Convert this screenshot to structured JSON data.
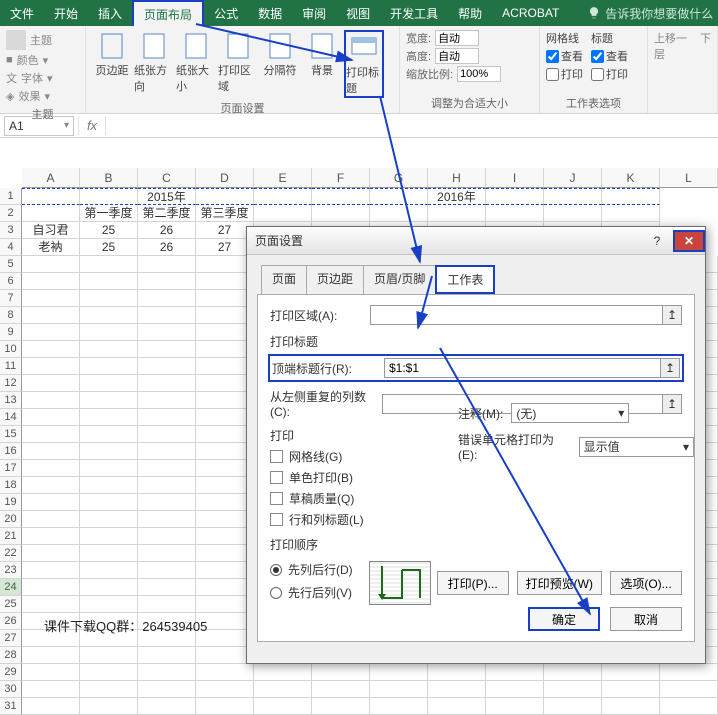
{
  "ribbon": {
    "tabs": [
      "文件",
      "开始",
      "插入",
      "页面布局",
      "公式",
      "数据",
      "审阅",
      "视图",
      "开发工具",
      "帮助",
      "ACROBAT"
    ],
    "active_tab": "页面布局",
    "tell_me": "告诉我你想要做什么",
    "themes": {
      "colors": "颜色",
      "fonts": "字体",
      "effects": "效果",
      "label": "主题",
      "main": "主题"
    },
    "page_setup": {
      "margins": "页边距",
      "orientation": "纸张方向",
      "size": "纸张大小",
      "print_area": "打印区域",
      "breaks": "分隔符",
      "background": "背景",
      "print_titles": "打印标题",
      "label": "页面设置"
    },
    "scale": {
      "width_label": "宽度:",
      "height_label": "高度:",
      "scale_label": "缩放比例:",
      "auto": "自动",
      "zoom": "100%",
      "label": "调整为合适大小"
    },
    "sheet_options": {
      "gridlines": "网格线",
      "headings": "标题",
      "view": "查看",
      "print": "打印",
      "label": "工作表选项"
    },
    "arrange": {
      "forward": "上移一层",
      "backward": "下"
    }
  },
  "namebox": "A1",
  "columns": [
    "A",
    "B",
    "C",
    "D",
    "E",
    "F",
    "G",
    "H",
    "I",
    "J",
    "K",
    "L"
  ],
  "years": {
    "y2015": "2015年",
    "y2016": "2016年"
  },
  "headers": {
    "q1": "第一季度",
    "q2": "第二季度",
    "q3": "第三季度"
  },
  "rows_data": [
    {
      "name": "自习君",
      "q1": "25",
      "q2": "26",
      "q3": "27"
    },
    {
      "name": "老衲",
      "q1": "25",
      "q2": "26",
      "q3": "27"
    }
  ],
  "watermark": "课件下载QQ群：264539405",
  "dialog": {
    "title": "页面设置",
    "tabs": [
      "页面",
      "页边距",
      "页眉/页脚",
      "工作表"
    ],
    "active_tab": "工作表",
    "print_area_label": "打印区域(A):",
    "print_titles_label": "打印标题",
    "top_rows_label": "顶端标题行(R):",
    "top_rows_value": "$1:$1",
    "left_cols_label": "从左侧重复的列数(C):",
    "print_section": "打印",
    "gridlines": "网格线(G)",
    "bw": "单色打印(B)",
    "draft": "草稿质量(Q)",
    "rowcol": "行和列标题(L)",
    "comments_label": "注释(M):",
    "comments_value": "(无)",
    "errors_label": "错误单元格打印为(E):",
    "errors_value": "显示值",
    "order_section": "打印顺序",
    "order_down": "先列后行(D)",
    "order_over": "先行后列(V)",
    "btn_print": "打印(P)...",
    "btn_preview": "打印预览(W)",
    "btn_options": "选项(O)...",
    "ok": "确定",
    "cancel": "取消"
  }
}
